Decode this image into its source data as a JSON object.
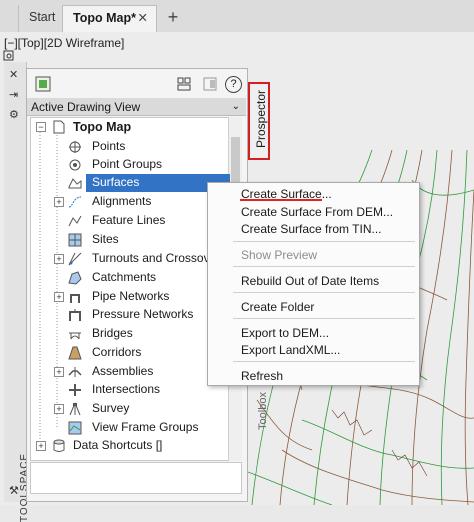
{
  "tabs": [
    {
      "label": "Start",
      "active": false
    },
    {
      "label": "Topo Map*",
      "active": true
    }
  ],
  "tab_close": "✕",
  "tab_add": "+",
  "viewport_label": "[−][Top][2D Wireframe]",
  "toolspace_label": "TOOLSPACE",
  "panel": {
    "dropdown_value": "Active Drawing View",
    "prospector_tab": "Prospector",
    "toolbox_tab": "Toolbox",
    "help_icon": "?"
  },
  "tree": {
    "root": "Topo Map",
    "items": [
      {
        "label": "Points",
        "icon": "points-icon"
      },
      {
        "label": "Point Groups",
        "icon": "point-groups-icon"
      },
      {
        "label": "Surfaces",
        "icon": "surfaces-icon"
      },
      {
        "label": "Alignments",
        "icon": "alignments-icon"
      },
      {
        "label": "Feature Lines",
        "icon": "feature-lines-icon"
      },
      {
        "label": "Sites",
        "icon": "sites-icon"
      },
      {
        "label": "Turnouts and Crossove",
        "icon": "turnouts-icon"
      },
      {
        "label": "Catchments",
        "icon": "catchments-icon"
      },
      {
        "label": "Pipe Networks",
        "icon": "pipe-networks-icon"
      },
      {
        "label": "Pressure Networks",
        "icon": "pressure-networks-icon"
      },
      {
        "label": "Bridges",
        "icon": "bridges-icon"
      },
      {
        "label": "Corridors",
        "icon": "corridors-icon"
      },
      {
        "label": "Assemblies",
        "icon": "assemblies-icon"
      },
      {
        "label": "Intersections",
        "icon": "intersections-icon"
      },
      {
        "label": "Survey",
        "icon": "survey-icon"
      },
      {
        "label": "View Frame Groups",
        "icon": "view-frame-groups-icon"
      }
    ],
    "data_shortcuts": "Data Shortcuts []"
  },
  "context_menu": {
    "items": [
      {
        "label": "Create Surface...",
        "enabled": true
      },
      {
        "label": "Create Surface From DEM...",
        "enabled": true
      },
      {
        "label": "Create Surface from TIN...",
        "enabled": true
      },
      {
        "label": "Show Preview",
        "enabled": false
      },
      {
        "label": "Rebuild Out of Date Items",
        "enabled": true
      },
      {
        "label": "Create Folder",
        "enabled": true
      },
      {
        "label": "Export to DEM...",
        "enabled": true
      },
      {
        "label": "Export LandXML...",
        "enabled": true
      },
      {
        "label": "Refresh",
        "enabled": true
      }
    ]
  },
  "colors": {
    "selection": "#3373c5",
    "highlight_box": "#d21f1f",
    "contour_green": "#2e9a3a",
    "contour_brown": "#8a5a3a"
  }
}
